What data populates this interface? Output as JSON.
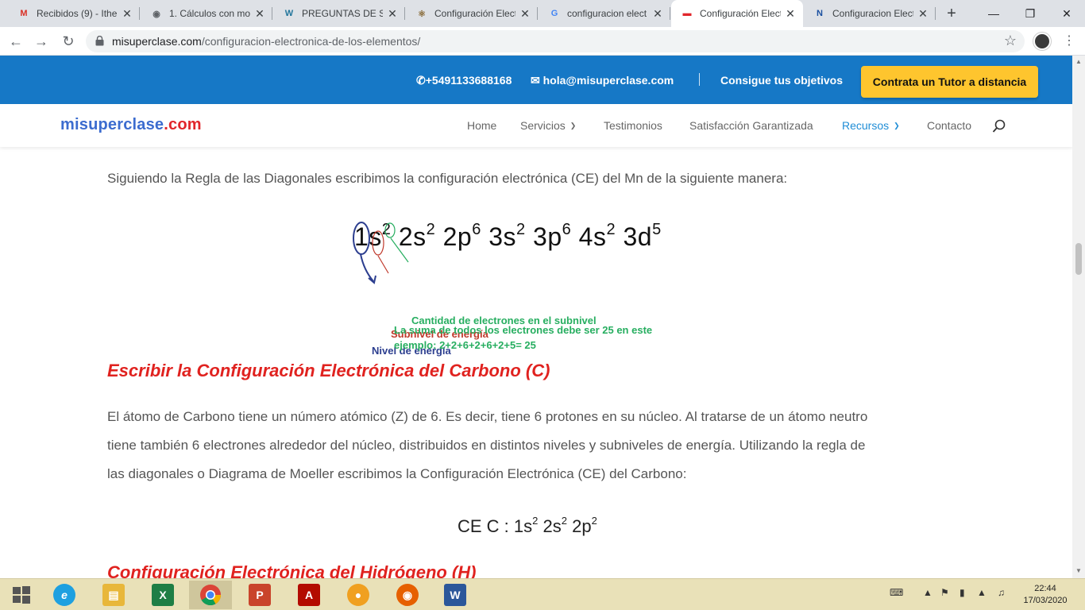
{
  "browser": {
    "tabs": [
      {
        "title": "Recibidos (9) - Ithe",
        "favicon": "gmail-icon",
        "fav_text": "M",
        "fav_color": "#d93025",
        "active": false
      },
      {
        "title": "1. Cálculos con mo",
        "favicon": "globe-icon",
        "fav_text": "◉",
        "fav_color": "#5f6368",
        "active": false
      },
      {
        "title": "PREGUNTAS DE SE",
        "favicon": "wordpress-icon",
        "fav_text": "W",
        "fav_color": "#21759b",
        "active": false
      },
      {
        "title": "Configuración Elect",
        "favicon": "atom-icon",
        "fav_text": "⚛",
        "fav_color": "#8a6d3b",
        "active": false
      },
      {
        "title": "configuracion elect",
        "favicon": "google-icon",
        "fav_text": "G",
        "fav_color": "#4285f4",
        "active": false
      },
      {
        "title": "Configuración Elect",
        "favicon": "misuperclase-icon",
        "fav_text": "▬",
        "fav_color": "#e1262b",
        "active": true
      },
      {
        "title": "Configuracion Elect",
        "favicon": "n-icon",
        "fav_text": "N",
        "fav_color": "#1a4fa0",
        "active": false
      }
    ],
    "new_tab": "+",
    "url_host": "misuperclase.com",
    "url_path": "/configuracion-electronica-de-los-elementos/"
  },
  "site": {
    "phone": "+5491133688168",
    "email": "hola@misuperclase.com",
    "slogan": "Consigue tus objetivos",
    "cta": "Contrata un Tutor a distancia",
    "logo_main": "misuperclase",
    "logo_tld": ".com",
    "nav": {
      "home": "Home",
      "servicios": "Servicios",
      "testimonios": "Testimonios",
      "satisfaccion": "Satisfacción Garantizada",
      "recursos": "Recursos",
      "contacto": "Contacto"
    },
    "colors": {
      "topbar": "#1678c6",
      "cta": "#fec52e",
      "heading": "#e0221f",
      "nav_active": "#1f8dd6"
    }
  },
  "article": {
    "intro": "Siguiendo la Regla de las Diagonales escribimos la configuración electrónica (CE) del Mn de la siguiente manera:",
    "figure": {
      "terms": [
        {
          "base": "1s",
          "exp": "2"
        },
        {
          "base": "2s",
          "exp": "2"
        },
        {
          "base": "2p",
          "exp": "6"
        },
        {
          "base": "3s",
          "exp": "2"
        },
        {
          "base": "3p",
          "exp": "6"
        },
        {
          "base": "4s",
          "exp": "2"
        },
        {
          "base": "3d",
          "exp": "5"
        }
      ],
      "label_electrons": "Cantidad de electrones en el subnivel",
      "label_subnivel": "Subnivel de energía",
      "label_nivel": "Nivel de energía",
      "note_line1": "La suma de todos los electrones debe ser 25 en este",
      "note_line2": "ejemplo: 2+2+6+2+6+2+5= 25"
    },
    "heading_carbono": "Escribir la Configuración Electrónica del Carbono (C)",
    "para_carbono_1": "El átomo de Carbono tiene un número atómico (Z) de 6. Es decir, tiene 6 protones en su núcleo. Al tratarse de un átomo neutro",
    "para_carbono_2": "tiene también 6 electrones alrededor del núcleo, distribuidos en distintos niveles y subniveles de energía. Utilizando la regla de",
    "para_carbono_3": "las diagonales o Diagrama de Moeller escribimos la Configuración Electrónica (CE) del Carbono:",
    "ce_carbono": {
      "prefix": "CE C : ",
      "terms": [
        {
          "base": "1s",
          "exp": "2"
        },
        {
          "base": "2s",
          "exp": "2"
        },
        {
          "base": "2p",
          "exp": "2"
        }
      ]
    },
    "heading_hidrogeno": "Configuración Electrónica del Hidrógeno (H)"
  },
  "taskbar": {
    "time": "22:44",
    "date": "17/03/2020",
    "apps": [
      "start-icon",
      "ie-icon",
      "file-explorer-icon",
      "excel-icon",
      "chrome-icon",
      "powerpoint-icon",
      "acrobat-icon",
      "vpn-icon",
      "firefox-icon",
      "word-icon"
    ]
  }
}
